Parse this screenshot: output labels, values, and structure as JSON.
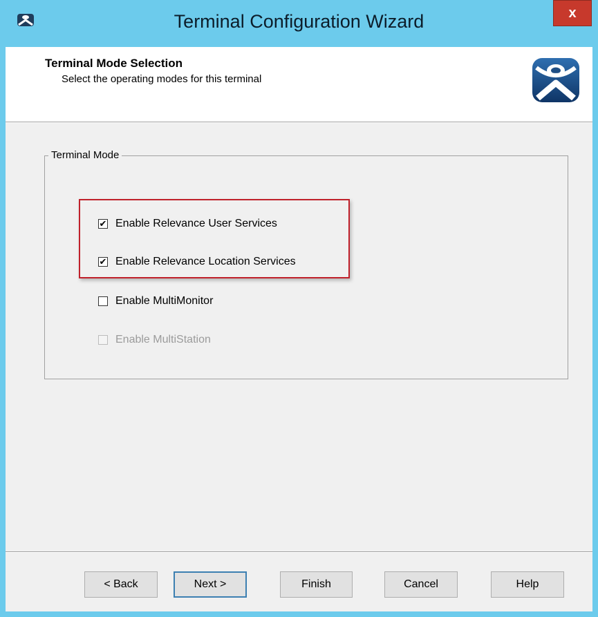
{
  "window": {
    "title": "Terminal Configuration Wizard",
    "close_label": "x",
    "accent_color": "#6ccbec"
  },
  "header": {
    "title": "Terminal Mode Selection",
    "subtitle": "Select the operating modes for this terminal",
    "logo_icon": "thinmanager-logo-icon"
  },
  "group": {
    "label": "Terminal Mode",
    "options": [
      {
        "label": "Enable Relevance User Services",
        "checked": true,
        "enabled": true
      },
      {
        "label": "Enable Relevance Location Services",
        "checked": true,
        "enabled": true
      },
      {
        "label": "Enable MultiMonitor",
        "checked": false,
        "enabled": true
      },
      {
        "label": "Enable MultiStation",
        "checked": false,
        "enabled": false
      }
    ]
  },
  "buttons": {
    "back": "< Back",
    "next": "Next >",
    "finish": "Finish",
    "cancel": "Cancel",
    "help": "Help"
  }
}
